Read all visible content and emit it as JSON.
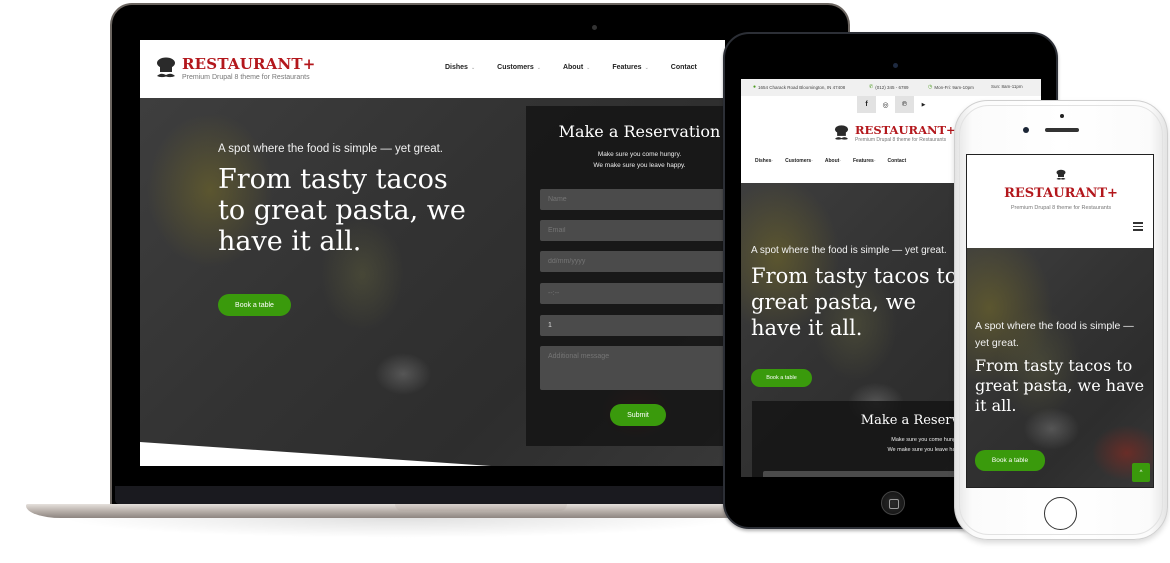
{
  "brand": {
    "name": "RESTAURANT+",
    "tagline": "Premium Drupal 8 theme for Restaurants",
    "logo_icon": "chef-hat-mustache-icon",
    "accent_color": "#b3171c",
    "button_color": "#3a9a0c"
  },
  "nav": {
    "items": [
      {
        "label": "Dishes",
        "has_dropdown": true
      },
      {
        "label": "Customers",
        "has_dropdown": true
      },
      {
        "label": "About",
        "has_dropdown": true
      },
      {
        "label": "Features",
        "has_dropdown": true
      },
      {
        "label": "Contact",
        "has_dropdown": false
      }
    ],
    "chevron": "⌄"
  },
  "topbar": {
    "address": "1654 Charack Road Bloomington, IN 47408",
    "phone": "(012) 345 - 6789",
    "hours_weekday": "Mon-Fri: 9am-10pm",
    "hours_weekend": "Sun: 8am-11pm",
    "social": [
      {
        "icon": "facebook-icon",
        "glyph": "f"
      },
      {
        "icon": "instagram-icon",
        "glyph": "◎"
      },
      {
        "icon": "pinterest-icon",
        "glyph": "℗"
      },
      {
        "icon": "youtube-icon",
        "glyph": "▶"
      }
    ]
  },
  "hero": {
    "subtitle": "A spot where the food is simple — yet great.",
    "title": "From tasty tacos to great pasta, we have it all.",
    "cta_label": "Book a table"
  },
  "reservation": {
    "title": "Make a Reservation",
    "line1": "Make sure you come hungry.",
    "line2": "We make sure you leave happy.",
    "fields": {
      "name_placeholder": "Name",
      "email_placeholder": "Email",
      "date_placeholder": "dd/mm/yyyy",
      "time_placeholder": "--:--",
      "guests_value": "1",
      "message_placeholder": "Additional message"
    },
    "submit_label": "Submit"
  },
  "phone": {
    "menu_icon": "hamburger-menu-icon",
    "back_to_top_glyph": "^"
  }
}
